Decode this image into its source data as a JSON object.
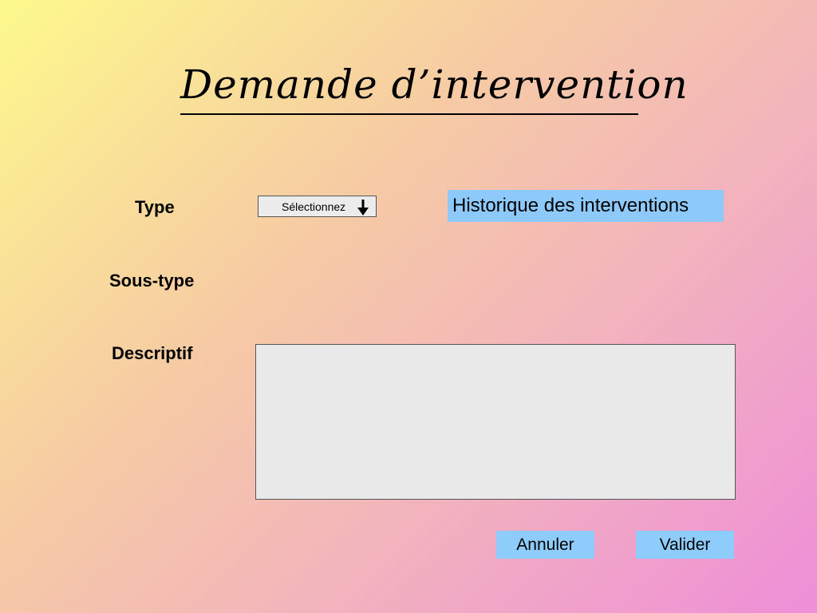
{
  "header": {
    "title": "Demande d’intervention"
  },
  "form": {
    "type_label": "Type",
    "type_select_value": "Sélectionnez",
    "subtype_label": "Sous-type",
    "description_label": "Descriptif",
    "description_value": ""
  },
  "history_button_label": "Historique des interventions",
  "actions": {
    "cancel_label": "Annuler",
    "validate_label": "Valider"
  },
  "icons": {
    "select_arrow": "arrow-down-icon"
  },
  "colors": {
    "button_blue": "#8ecdfb",
    "history_blue": "#8ec9fb",
    "field_gray": "#e9e9e9"
  }
}
